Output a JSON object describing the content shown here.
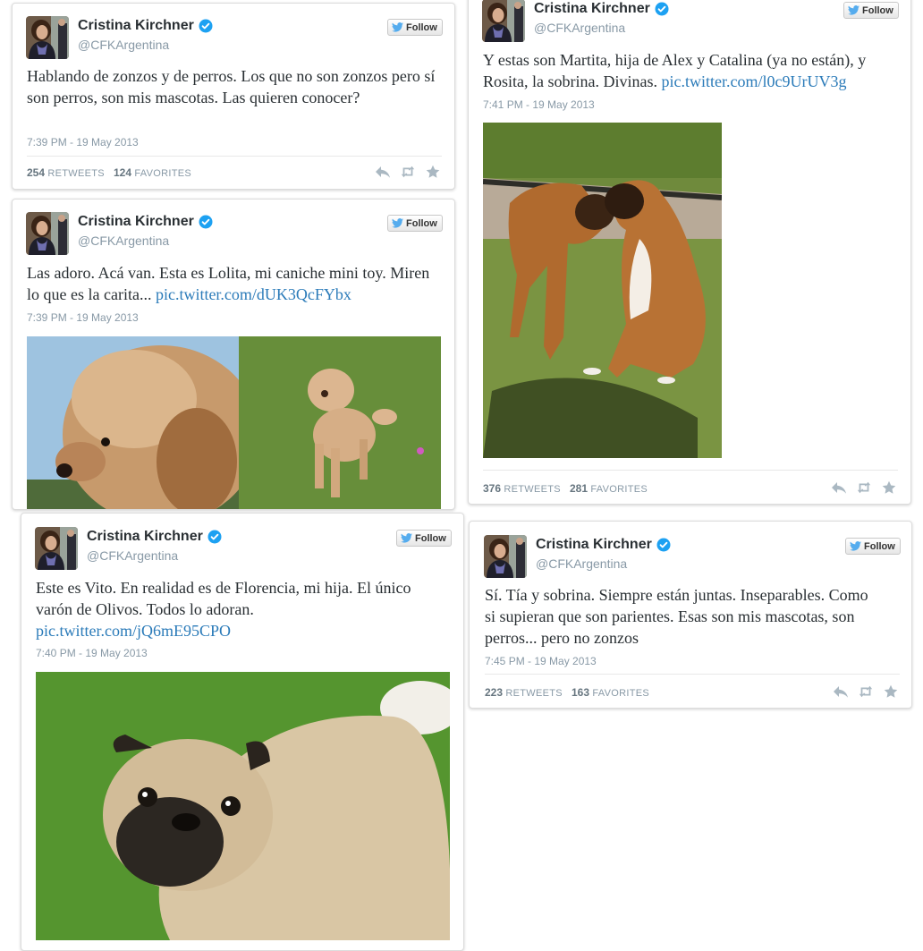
{
  "tweets": [
    {
      "name": "Cristina Kirchner",
      "handle": "@CFKArgentina",
      "follow_label": "Follow",
      "text": "Hablando de zonzos y de perros. Los que no son zonzos pero sí son perros, son mis mascotas. Las quieren conocer?",
      "link": "",
      "time": "7:39 PM - 19 May 2013",
      "retweets": "254",
      "retweets_label": "RETWEETS",
      "favorites": "124",
      "favorites_label": "FAVORITES"
    },
    {
      "name": "Cristina Kirchner",
      "handle": "@CFKArgentina",
      "follow_label": "Follow",
      "text": "Las adoro. Acá van. Esta es Lolita, mi caniche mini toy. Miren lo que es la carita...",
      "link": "pic.twitter.com/dUK3QcFYbx",
      "time": "7:39 PM - 19 May 2013",
      "image": "poodle-photos"
    },
    {
      "name": "Cristina Kirchner",
      "handle": "@CFKArgentina",
      "follow_label": "Follow",
      "text": "Y estas son Martita, hija de Alex y Catalina (ya no están), y Rosita, la sobrina. Divinas.",
      "link": "pic.twitter.com/l0c9UrUV3g",
      "time": "7:41 PM - 19 May 2013",
      "image": "boxer-dogs-photo",
      "retweets": "376",
      "retweets_label": "RETWEETS",
      "favorites": "281",
      "favorites_label": "FAVORITES"
    },
    {
      "name": "Cristina Kirchner",
      "handle": "@CFKArgentina",
      "follow_label": "Follow",
      "text": "Este es Vito. En realidad es de Florencia, mi hija. El único varón de Olivos. Todos lo adoran.",
      "link": "pic.twitter.com/jQ6mE95CPO",
      "time": "7:40 PM - 19 May 2013",
      "image": "pug-photo"
    },
    {
      "name": "Cristina Kirchner",
      "handle": "@CFKArgentina",
      "follow_label": "Follow",
      "text": "Sí. Tía y sobrina. Siempre están juntas. Inseparables. Como si supieran que son parientes. Esas son mis mascotas, son perros... pero no zonzos",
      "link": "",
      "time": "7:45 PM - 19 May 2013",
      "retweets": "223",
      "retweets_label": "RETWEETS",
      "favorites": "163",
      "favorites_label": "FAVORITES"
    }
  ],
  "colors": {
    "link": "#2b7bb9",
    "verified": "#1da1f2",
    "follow_bird": "#55acee",
    "muted": "#8899a6"
  },
  "icons": [
    "verified-icon",
    "twitter-bird-icon",
    "reply-icon",
    "retweet-icon",
    "favorite-icon"
  ]
}
